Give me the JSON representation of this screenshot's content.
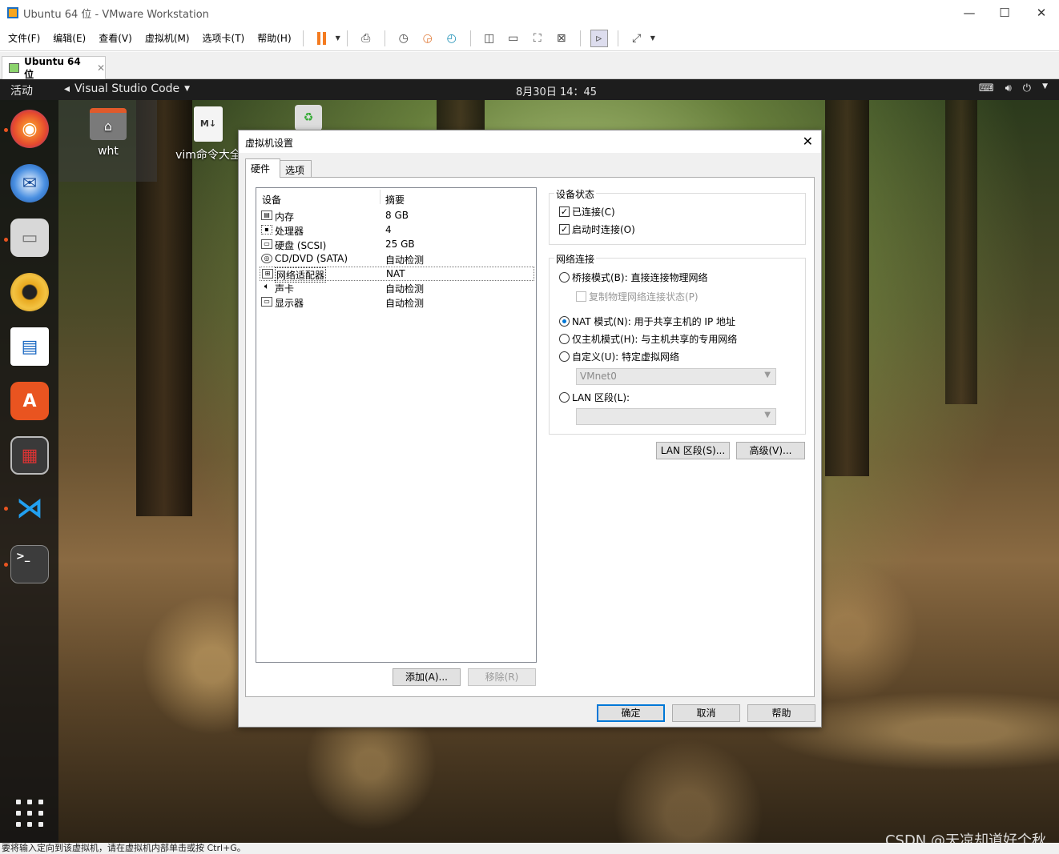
{
  "window": {
    "title": "Ubuntu 64 位 - VMware Workstation",
    "minimize": "—",
    "maximize": "☐",
    "close": "✕"
  },
  "menubar": {
    "items": [
      "文件(F)",
      "编辑(E)",
      "查看(V)",
      "虚拟机(M)",
      "选项卡(T)",
      "帮助(H)"
    ]
  },
  "vm_tab": {
    "label": "Ubuntu 64 位",
    "close": "✕"
  },
  "guest": {
    "activities": "活动",
    "app_menu": "Visual Studio Code",
    "clock": "8月30日  14：45",
    "desktop_icons": [
      "wht",
      "vim命令大全"
    ],
    "status_text": "要将输入定向到该虚拟机，请在虚拟机内部单击或按 Ctrl+G。",
    "watermark": "CSDN @天凉却道好个秋"
  },
  "dialog": {
    "title": "虚拟机设置",
    "close": "✕",
    "tabs": [
      "硬件",
      "选项"
    ],
    "device_list": {
      "headers": [
        "设备",
        "摘要"
      ],
      "rows": [
        {
          "name": "内存",
          "summary": "8 GB"
        },
        {
          "name": "处理器",
          "summary": "4"
        },
        {
          "name": "硬盘 (SCSI)",
          "summary": "25 GB"
        },
        {
          "name": "CD/DVD (SATA)",
          "summary": "自动检测"
        },
        {
          "name": "网络适配器",
          "summary": "NAT"
        },
        {
          "name": "声卡",
          "summary": "自动检测"
        },
        {
          "name": "显示器",
          "summary": "自动检测"
        }
      ],
      "selected": "网络适配器"
    },
    "add_button": "添加(A)...",
    "remove_button": "移除(R)",
    "device_status": {
      "label": "设备状态",
      "connected": "已连接(C)",
      "connect_at_power_on": "启动时连接(O)",
      "connected_checked": true,
      "power_on_checked": true
    },
    "network": {
      "label": "网络连接",
      "bridged": "桥接模式(B): 直接连接物理网络",
      "replicate": "复制物理网络连接状态(P)",
      "nat": "NAT 模式(N): 用于共享主机的 IP 地址",
      "host_only": "仅主机模式(H): 与主机共享的专用网络",
      "custom": "自定义(U): 特定虚拟网络",
      "custom_value": "VMnet0",
      "lan_segment": "LAN 区段(L):",
      "lan_value": "",
      "selected": "nat"
    },
    "lan_segments_button": "LAN 区段(S)...",
    "advanced_button": "高级(V)...",
    "ok_button": "确定",
    "cancel_button": "取消",
    "help_button": "帮助"
  }
}
